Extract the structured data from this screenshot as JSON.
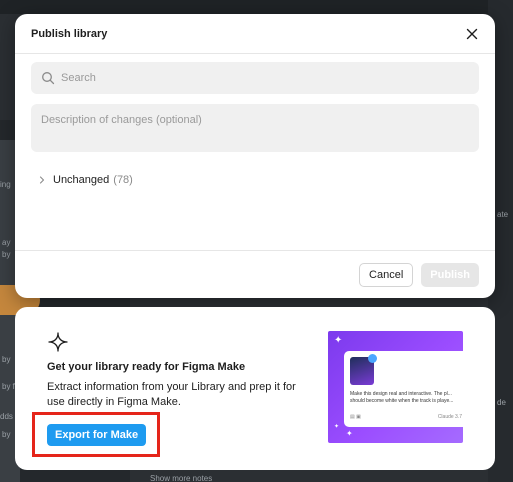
{
  "background": {
    "fragments": [
      "ing",
      "ay",
      "by",
      "by",
      "by fu",
      "dds",
      "by",
      "ate",
      "de",
      "Show more notes"
    ]
  },
  "modal": {
    "title": "Publish library",
    "search": {
      "placeholder": "Search",
      "value": ""
    },
    "description": {
      "placeholder": "Description of changes (optional)",
      "value": ""
    },
    "unchanged": {
      "label": "Unchanged",
      "count": "(78)"
    },
    "footer": {
      "cancel_label": "Cancel",
      "publish_label": "Publish"
    }
  },
  "promo": {
    "title": "Get your library ready for Figma Make",
    "description": "Extract information from your Library and prep it for use directly in Figma Make.",
    "export_label": "Export for Make",
    "preview": {
      "text": "Make this design real and interactive. The pl... should become white when the track is playe...",
      "model": "Claude 3.7"
    }
  },
  "colors": {
    "accent": "#1e9bf0",
    "highlight": "#e5251a",
    "preview_purple": "#7c3aed"
  },
  "icons": {
    "close": "close-icon",
    "search": "search-icon",
    "chevron": "chevron-right-icon",
    "figma_make": "figma-make-icon"
  }
}
